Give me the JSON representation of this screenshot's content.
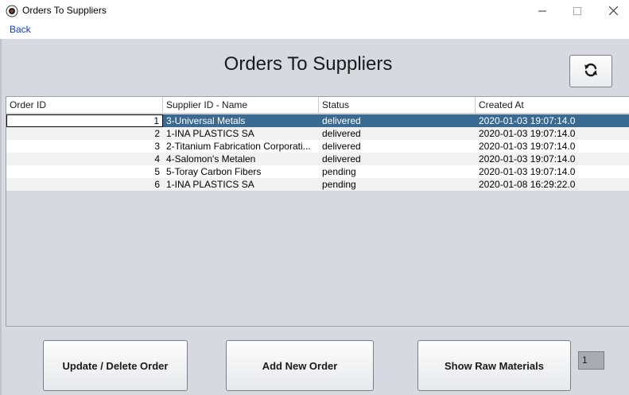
{
  "window": {
    "title": "Orders To Suppliers"
  },
  "menu": {
    "back_label": "Back"
  },
  "page": {
    "title": "Orders To Suppliers"
  },
  "table": {
    "columns": [
      "Order ID",
      "Supplier ID - Name",
      "Status",
      "Created At"
    ],
    "selected_row_index": 0,
    "rows": [
      {
        "id": "1",
        "supplier": "3-Universal Metals",
        "status": "delivered",
        "created": "2020-01-03 19:07:14.0"
      },
      {
        "id": "2",
        "supplier": "1-INA PLASTICS SA",
        "status": "delivered",
        "created": "2020-01-03 19:07:14.0"
      },
      {
        "id": "3",
        "supplier": "2-Titanium Fabrication Corporati...",
        "status": "delivered",
        "created": "2020-01-03 19:07:14.0"
      },
      {
        "id": "4",
        "supplier": "4-Salomon's Metalen",
        "status": "delivered",
        "created": "2020-01-03 19:07:14.0"
      },
      {
        "id": "5",
        "supplier": "5-Toray Carbon Fibers",
        "status": "pending",
        "created": "2020-01-03 19:07:14.0"
      },
      {
        "id": "6",
        "supplier": "1-INA PLASTICS SA",
        "status": "pending",
        "created": "2020-01-08 16:29:22.0"
      }
    ]
  },
  "buttons": {
    "update_delete": "Update / Delete Order",
    "add_new": "Add New Order",
    "show_raw": "Show Raw Materials"
  },
  "count_field": {
    "value": "1"
  },
  "colors": {
    "selection": "#3a6a91",
    "background": "#d6d9df",
    "link": "#0a3ccf"
  }
}
